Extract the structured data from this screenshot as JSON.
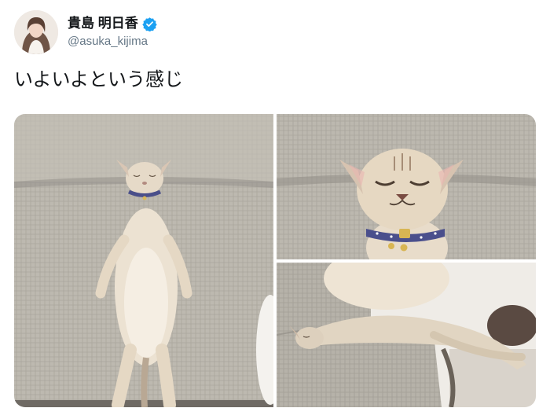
{
  "tweet": {
    "author": {
      "display_name": "貴島 明日香",
      "handle": "@asuka_kijima",
      "verified": true
    },
    "text": "いよいよという感じ",
    "media": [
      {
        "kind": "photo",
        "subject": "cat lying on back on gray sofa"
      },
      {
        "kind": "photo",
        "subject": "sleeping cat face with blue collar"
      },
      {
        "kind": "photo",
        "subject": "cat stretched across sofa arm"
      }
    ]
  },
  "colors": {
    "verified_badge": "#1da1f2",
    "handle_text": "#657786",
    "body_text": "#14171a",
    "sofa_gray": "#b9b6ad",
    "cat_cream": "#ece2d2"
  }
}
